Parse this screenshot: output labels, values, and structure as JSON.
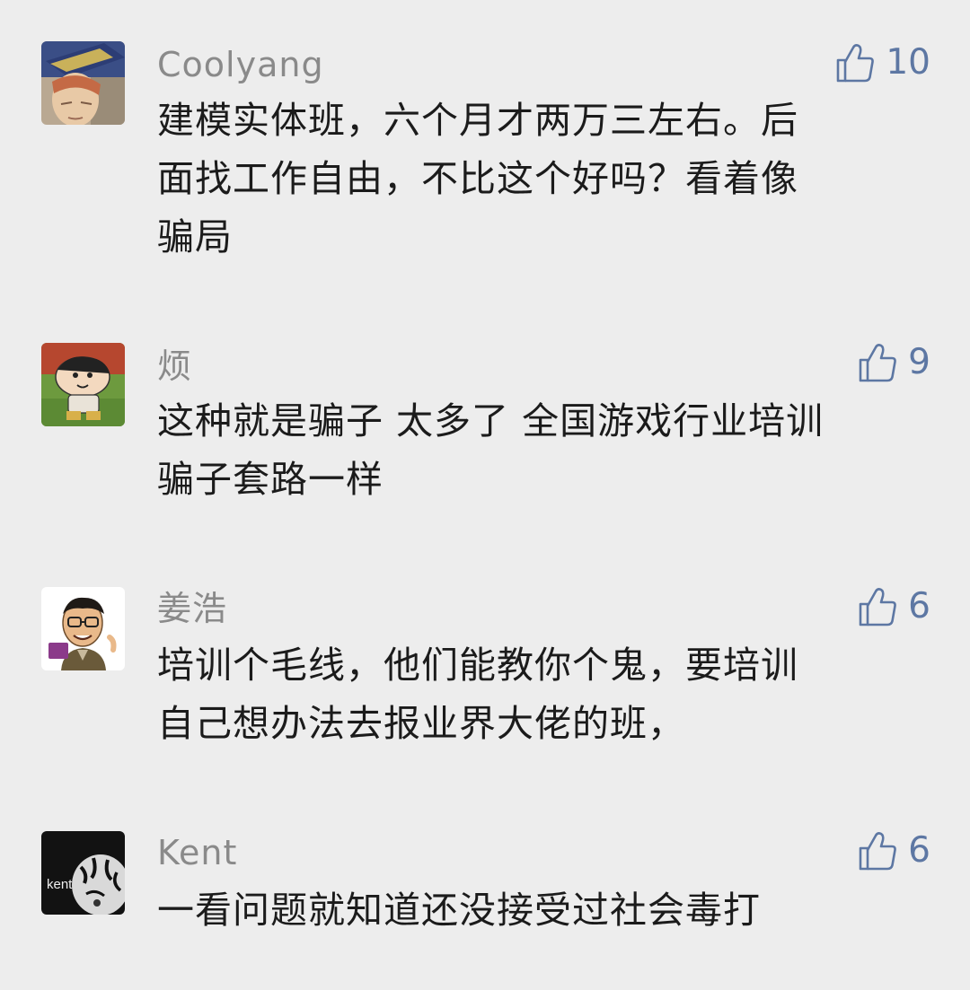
{
  "comments": [
    {
      "name": "Coolyang",
      "likes": "10",
      "lines": [
        "建模实体班，六个月才两万三左右。后",
        "面找工作自由，不比这个好吗？看着像",
        "骗局"
      ],
      "avatar_icon": "anime-character-avatar-icon"
    },
    {
      "name": "烦",
      "likes": "9",
      "lines": [
        "这种就是骗子 太多了 全国游戏行业培训",
        "骗子套路一样"
      ],
      "avatar_icon": "cartoon-boy-avatar-icon"
    },
    {
      "name": "姜浩",
      "likes": "6",
      "lines": [
        "培训个毛线，他们能教你个鬼，要培训",
        "自己想办法去报业界大佬的班，"
      ],
      "avatar_icon": "caricature-man-avatar-icon"
    },
    {
      "name": "Kent",
      "likes": "6",
      "lines": [
        "一看问题就知道还没接受过社会毒打"
      ],
      "avatar_icon": "tiger-kent-avatar-icon",
      "avatar_text": "kent"
    }
  ],
  "colors": {
    "background": "#ededed",
    "name": "#8a8a8a",
    "like": "#5d77a3",
    "text": "#1b1b1b"
  }
}
